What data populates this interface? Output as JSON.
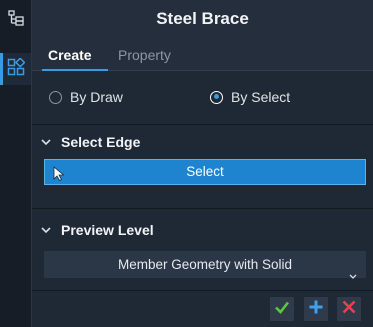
{
  "rail": {
    "items": [
      {
        "icon": "tree-view-icon",
        "active": false
      },
      {
        "icon": "grid-add-icon",
        "active": true
      }
    ]
  },
  "panel": {
    "title": "Steel Brace",
    "tabs": [
      {
        "label": "Create",
        "active": true
      },
      {
        "label": "Property",
        "active": false
      }
    ],
    "mode": {
      "options": [
        "By Draw",
        "By Select"
      ],
      "selected": "By Select"
    },
    "select_edge": {
      "heading": "Select Edge",
      "button_label": "Select"
    },
    "preview_level": {
      "heading": "Preview Level",
      "selected": "Member Geometry with Solid"
    },
    "footer": {
      "buttons": [
        "confirm-icon",
        "add-icon",
        "close-icon"
      ]
    }
  },
  "colors": {
    "accent": "#3b9be0",
    "select_button": "#1f84cf",
    "confirm": "#58c93a",
    "add": "#3f9ff0",
    "cancel": "#e8434a"
  }
}
